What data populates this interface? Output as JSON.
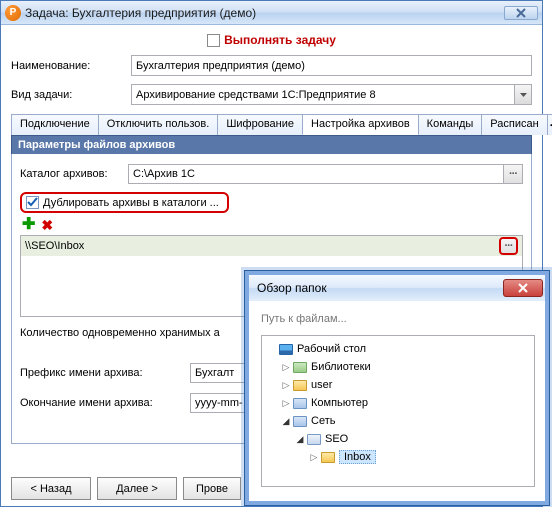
{
  "window": {
    "title": "Задача: Бухгалтерия предприятия (демо)",
    "app_icon_label": "P"
  },
  "execute": {
    "label": "Выполнять задачу",
    "checked": false
  },
  "form": {
    "name_label": "Наименование:",
    "name_value": "Бухгалтерия предприятия (демо)",
    "type_label": "Вид задачи:",
    "type_value": "Архивирование средствами 1С:Предприятие 8"
  },
  "tabs": {
    "items": [
      "Подключение",
      "Отключить пользов.",
      "Шифрование",
      "Настройка архивов",
      "Команды",
      "Расписан"
    ],
    "scroll_left": "◂",
    "scroll_right": "▸",
    "active_index": 3
  },
  "section": {
    "title": "Параметры файлов архивов",
    "catalog_label": "Каталог архивов:",
    "catalog_value": "C:\\Архив 1С",
    "browse_dots": "···",
    "duplicate_label": "Дублировать архивы в каталоги ...",
    "duplicate_checked": true,
    "list": {
      "items": [
        {
          "path": "\\\\SEO\\Inbox"
        }
      ]
    },
    "count_label": "Количество одновременно хранимых а",
    "prefix_label": "Префикс имени архива:",
    "prefix_value": "Бухгалт",
    "suffix_label": "Окончание имени архива:",
    "suffix_value": "yyyy-mm-"
  },
  "footer": {
    "back": "< Назад",
    "next": "Далее >",
    "check": "Прове"
  },
  "dialog": {
    "title": "Обзор папок",
    "path_hint": "Путь к файлам...",
    "tree": {
      "desktop": "Рабочий стол",
      "libraries": "Библиотеки",
      "user": "user",
      "computer": "Компьютер",
      "network": "Сеть",
      "seo": "SEO",
      "inbox": "Inbox"
    }
  }
}
